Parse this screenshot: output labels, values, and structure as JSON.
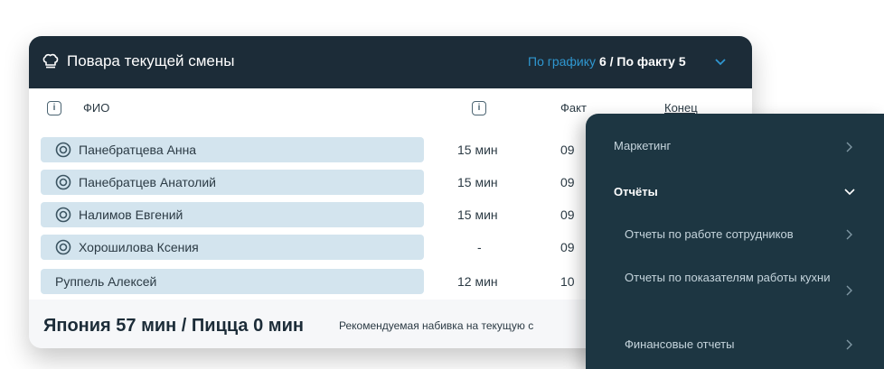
{
  "card": {
    "title": "Повара текущей смены",
    "plan_label": "По графику",
    "plan_count": "6",
    "separator": " / ",
    "fact_label": "По факту",
    "fact_count": "5"
  },
  "columns": {
    "name": "ФИО",
    "fact": "Факт",
    "end": "Конец",
    "info_glyph": "i"
  },
  "rows": [
    {
      "name": "Панебратцева Анна",
      "time": "15 мин",
      "fact": "09",
      "has_icon": true,
      "highlight": true
    },
    {
      "name": "Панебратцев Анатолий",
      "time": "15 мин",
      "fact": "09",
      "has_icon": true,
      "highlight": true
    },
    {
      "name": "Налимов Евгений",
      "time": "15 мин",
      "fact": "09",
      "has_icon": true,
      "highlight": true
    },
    {
      "name": "Хорошилова Ксения",
      "time": "-",
      "fact": "09",
      "has_icon": true,
      "highlight": true
    },
    {
      "name": "Руппель Алексей",
      "time": "12 мин",
      "fact": "10",
      "has_icon": false,
      "highlight": true
    }
  ],
  "footer": {
    "totals": "Япония 57 мин / Пицца 0 мин",
    "note": "Рекомендуемая набивка на текущую с"
  },
  "menu": {
    "items": [
      {
        "label": "Маркетинг",
        "level": 1,
        "expanded": false
      },
      {
        "label": "Отчёты",
        "level": 1,
        "expanded": true
      },
      {
        "label": "Отчеты по работе сотрудников",
        "level": 2,
        "expanded": false
      },
      {
        "label": "Отчеты по показателям работы кухни",
        "level": 2,
        "expanded": false
      },
      {
        "label": "Финансовые отчеты",
        "level": 2,
        "expanded": false
      }
    ]
  },
  "colors": {
    "header_bg": "#1c2c38",
    "plan_link": "#2f97d0",
    "row_pill": "#d3e4ee",
    "menu_bg": "#1d3642"
  }
}
